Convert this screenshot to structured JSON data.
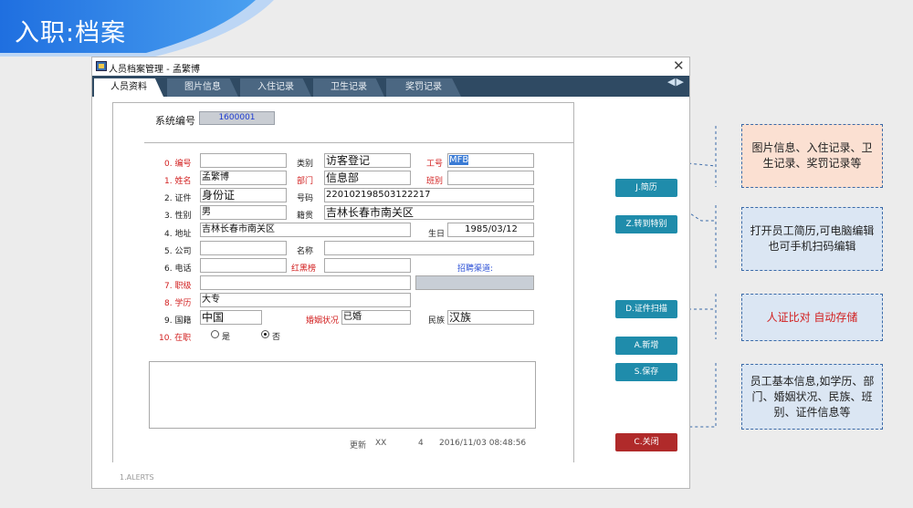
{
  "banner": {
    "title": "入职:档案"
  },
  "window": {
    "title": "人员档案管理 - 孟繁博",
    "tabs": [
      "人员资料",
      "图片信息",
      "入住记录",
      "卫生记录",
      "奖罚记录"
    ],
    "tab_arrows": "◀▶",
    "close": "✕"
  },
  "form": {
    "sysno_label": "系统编号",
    "sysno_value": "1600001",
    "row1": {
      "label": "0. 编号",
      "value": "",
      "cat_label": "类别",
      "cat_value": "访客登记",
      "job_label": "工号",
      "job_value": "MFB"
    },
    "row2": {
      "label": "1. 姓名",
      "value": "孟繁博",
      "dept_label": "部门",
      "dept_value": "信息部",
      "shift_label": "班别",
      "shift_value": ""
    },
    "row3": {
      "label": "2. 证件",
      "value": "身份证",
      "num_label": "号码",
      "num_value": "220102198503122217"
    },
    "row4": {
      "label": "3. 性别",
      "value": "男",
      "origin_label": "籍贯",
      "origin_value": "吉林长春市南关区"
    },
    "row5": {
      "label": "4. 地址",
      "value": "吉林长春市南关区",
      "birth_label": "生日",
      "birth_value": "1985/03/12"
    },
    "row6": {
      "label": "5. 公司",
      "value": "",
      "name_label": "名称",
      "name_value": ""
    },
    "row7": {
      "label": "6. 电话",
      "value": "",
      "blacklist_label": "红黑榜",
      "blacklist_value": "",
      "channel_label": "招聘渠道:",
      "channel_value": ""
    },
    "row8": {
      "label": "7. 职级",
      "value": ""
    },
    "row9": {
      "label": "8. 学历",
      "value": "大专"
    },
    "row10": {
      "label": "9. 国籍",
      "value": "中国",
      "marital_label": "婚姻状况",
      "marital_value": "已婚",
      "ethnic_label": "民族",
      "ethnic_value": "汉族"
    },
    "row11": {
      "label": "10. 在职",
      "yes": "是",
      "no": "否",
      "selected": "否"
    }
  },
  "footer": {
    "update": "更新",
    "user": "XX",
    "count": "4",
    "datetime": "2016/11/03 08:48:56",
    "alerts": "1.ALERTS"
  },
  "buttons": {
    "resume": "J.简历",
    "transfer": "Z.转到特别",
    "scan": "D.证件扫描",
    "add": "A.新增",
    "save": "S.保存",
    "close": "C.关闭"
  },
  "callouts": {
    "c1": "图片信息、入住记录、卫生记录、奖罚记录等",
    "c2": "打开员工简历,可电脑编辑也可手机扫码编辑",
    "c3": "人证比对 自动存储",
    "c4": "员工基本信息,如学历、部门、婚姻状况、民族、班别、证件信息等"
  },
  "colors": {
    "banner": "#2f7fe0",
    "tabbar": "#2f4a63",
    "button": "#1f8cab",
    "close_button": "#b02a2a",
    "required_label": "#d21f1f"
  }
}
